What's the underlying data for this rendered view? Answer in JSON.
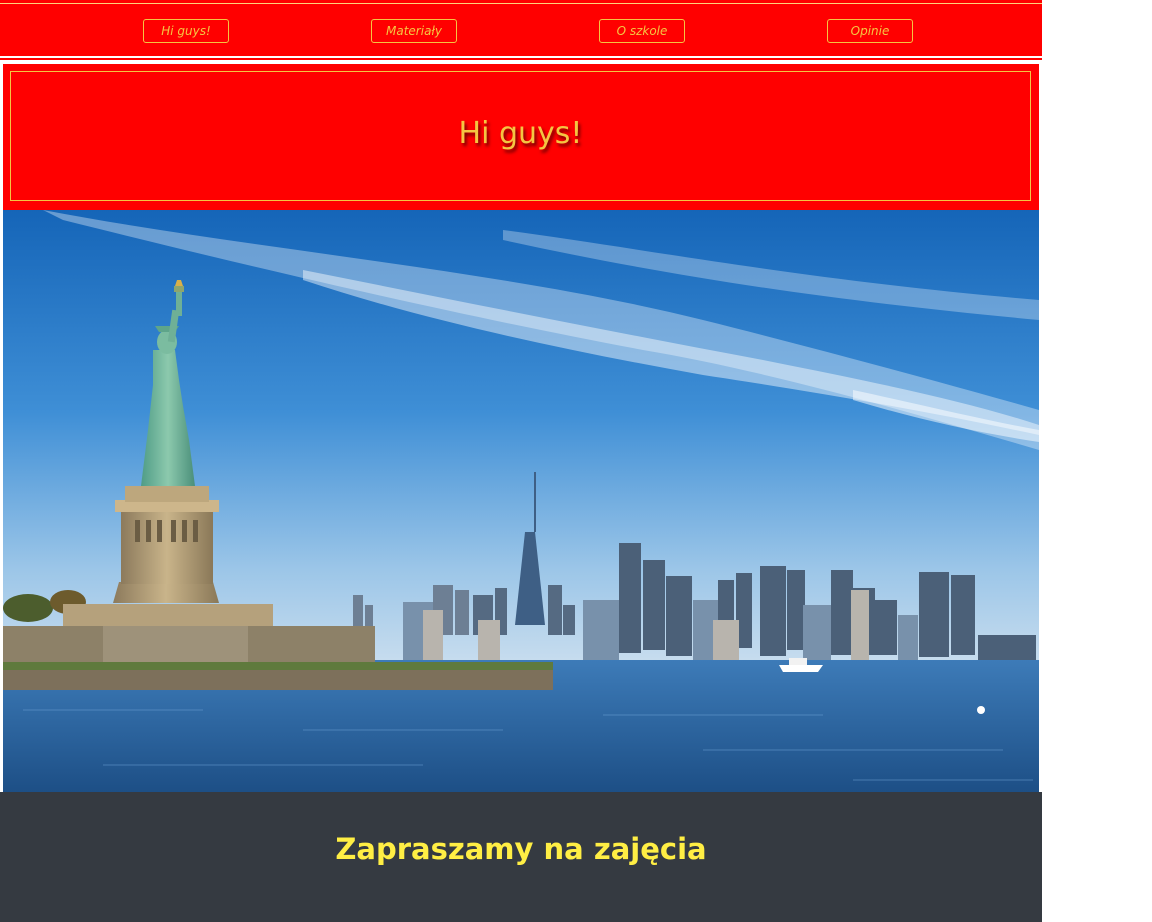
{
  "nav": {
    "items": [
      {
        "label": "Hi guys!"
      },
      {
        "label": "Materiały"
      },
      {
        "label": "O szkole"
      },
      {
        "label": "Opinie"
      }
    ]
  },
  "header": {
    "title": "Hi guys!"
  },
  "hero": {
    "icon": "statue-of-liberty-skyline-photo"
  },
  "footer": {
    "title": "Zapraszamy na zajęcia"
  },
  "colors": {
    "primary_red": "#ff0000",
    "gold": "#f5c542",
    "footer_bg": "#353a41",
    "footer_text": "#ffee44"
  }
}
